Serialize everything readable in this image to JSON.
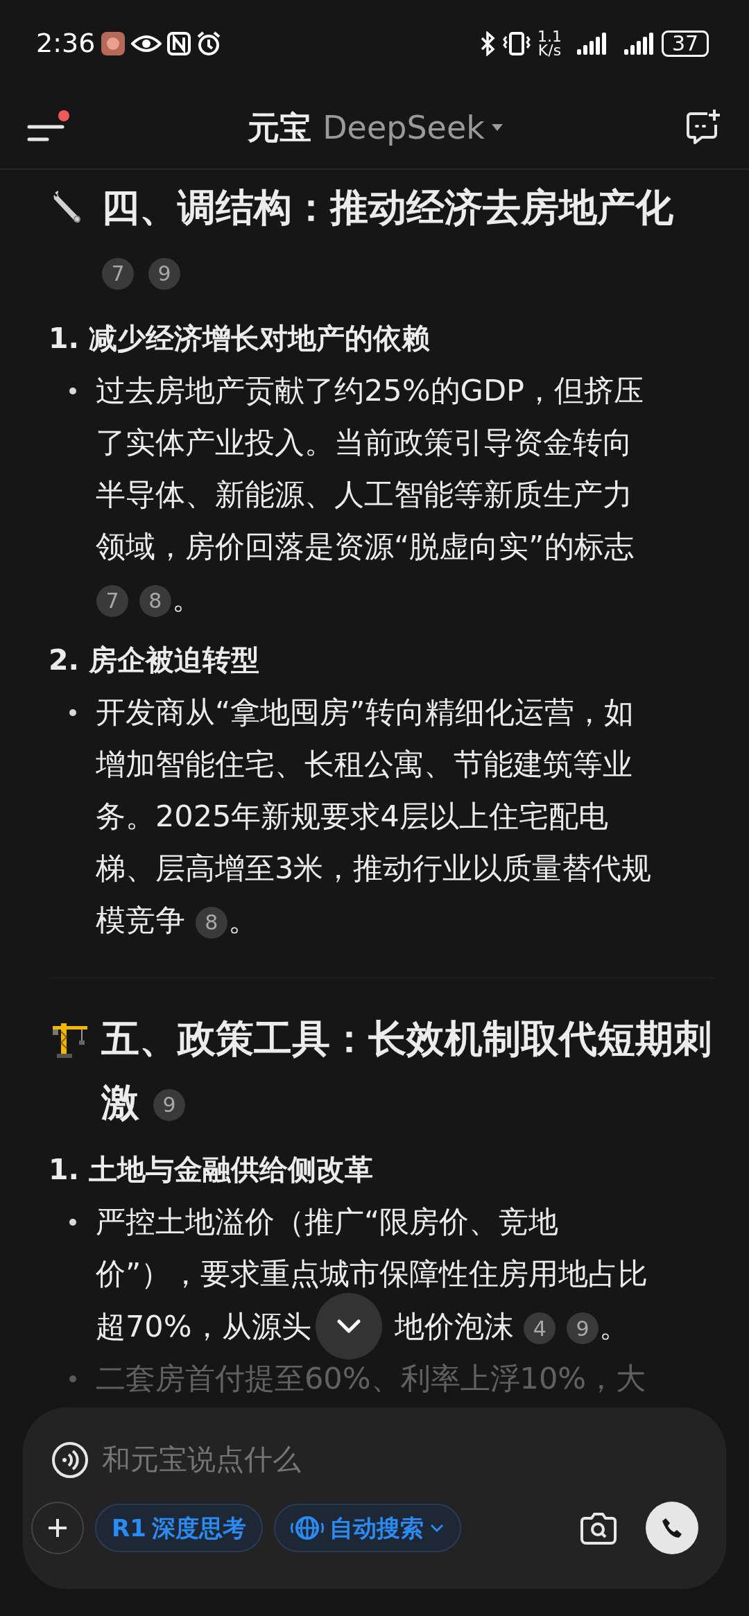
{
  "status_bar": {
    "time": "2:36",
    "net_speed": "1.1",
    "net_unit": "K/s",
    "battery": "37"
  },
  "header": {
    "title": "元宝",
    "model": "DeepSeek",
    "menu_badge": true
  },
  "sections": [
    {
      "title": "四、调结构：推动经济去房地产化",
      "citations": [
        "7",
        "9"
      ],
      "items": [
        {
          "number": "1.",
          "title": "减少经济增长对地产的依赖",
          "bullets": [
            {
              "text": "过去房地产贡献了约25%的GDP，但挤压了实体产业投入。当前政策引导资金转向半导体、新能源、人工智能等新质生产力领域，房价回落是资源“脱虚向实”的标志",
              "citations": [
                "7",
                "8"
              ],
              "end": "。",
              "faded": false
            }
          ]
        },
        {
          "number": "2.",
          "title": "房企被迫转型",
          "bullets": [
            {
              "text": "开发商从“拿地囤房”转向精细化运营，如增加智能住宅、长租公寓、节能建筑等业务。2025年新规要求4层以上住宅配电梯、层高增至3米，推动行业以质量替代规模竞争",
              "citations": [
                "8"
              ],
              "end": "。",
              "faded": false
            }
          ]
        }
      ]
    },
    {
      "title": "五、政策工具：长效机制取代短期刺激",
      "citations": [
        "9"
      ],
      "items": [
        {
          "number": "1.",
          "title": "土地与金融供给侧改革",
          "bullets": [
            {
              "text": "严控土地溢价（推广“限房价、竞地价”），要求重点城市保障性住房用地占比",
              "text_before_cover": "超70%，从源头",
              "text_after_cover": "地价泡沫",
              "citations": [
                "4",
                "9"
              ],
              "end": "。",
              "faded": false
            },
            {
              "text": "二套房首付提至60%、利率上浮10%，大",
              "faded": true
            }
          ]
        }
      ]
    }
  ],
  "input": {
    "placeholder": "和元宝说点什么"
  },
  "chips": [
    {
      "kind": "r1",
      "badge": "R1",
      "label": "深度思考",
      "selected": true
    },
    {
      "kind": "search",
      "label": "自动搜索",
      "selected": true
    }
  ]
}
